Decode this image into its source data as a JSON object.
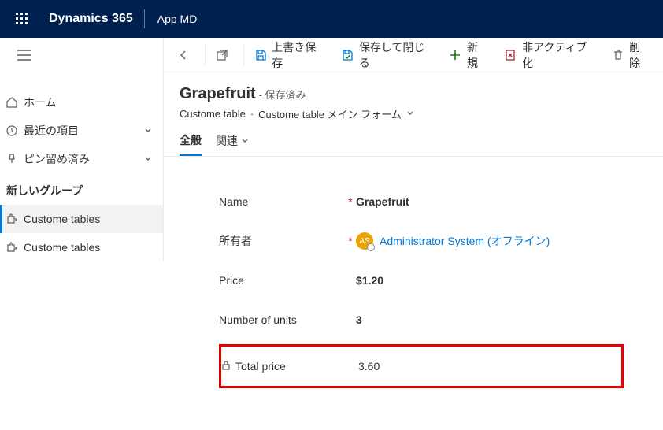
{
  "topbar": {
    "brand": "Dynamics 365",
    "app": "App MD"
  },
  "sidebar": {
    "home": "ホーム",
    "recent": "最近の項目",
    "pinned": "ピン留め済み",
    "group": "新しいグループ",
    "custom1": "Custome tables",
    "custom2": "Custome tables"
  },
  "cmdbar": {
    "save": "上書き保存",
    "saveClose": "保存して閉じる",
    "new": "新規",
    "deactivate": "非アクティブ化",
    "delete": "削除"
  },
  "header": {
    "title": "Grapefruit",
    "statusPrefix": "- ",
    "status": "保存済み",
    "bc1": "Custome table",
    "sep": "·",
    "bc2": "Custome table メイン フォーム"
  },
  "tabs": {
    "general": "全般",
    "related": "関連"
  },
  "fields": {
    "name": {
      "label": "Name",
      "value": "Grapefruit"
    },
    "owner": {
      "label": "所有者",
      "link": "Administrator System (オフライン)",
      "avatar": "AS"
    },
    "price": {
      "label": "Price",
      "value": "$1.20"
    },
    "units": {
      "label": "Number of units",
      "value": "3"
    },
    "total": {
      "label": "Total price",
      "value": "3.60"
    }
  }
}
